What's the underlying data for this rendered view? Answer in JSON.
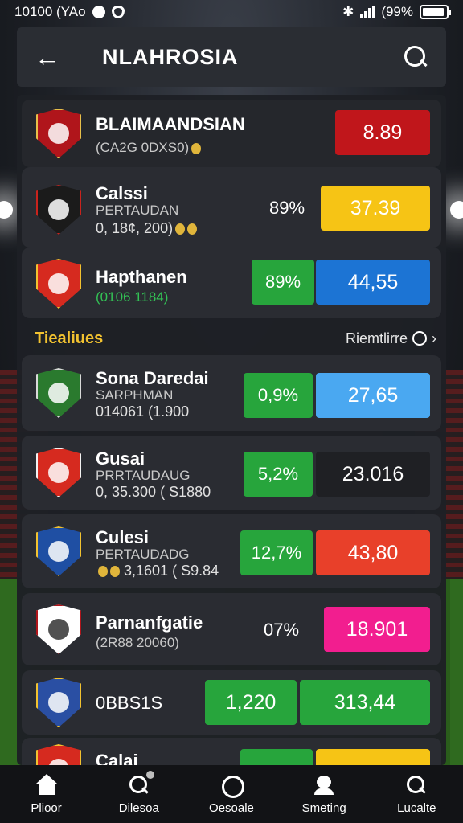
{
  "status_bar": {
    "time": "10100 (YAo",
    "battery": "(99%"
  },
  "header": {
    "title": "NLAHROSIA"
  },
  "featured": [
    {
      "name": "BLAIMAANDSIAN",
      "sub": "(CA2G 0DXS0)",
      "odds": "8.89",
      "odds_color": "#c0161b",
      "logo_color": "#b0151b"
    },
    {
      "name": "Calssi",
      "sub": "PERTAUDAN",
      "sub2": "0, 18¢, 200)",
      "pct": "89%",
      "odds": "37.39",
      "odds_color": "#f6c415",
      "logo_color": "#1b1b1b"
    },
    {
      "name": "Hapthanen",
      "sub": "(0106 1184)",
      "pct": "89%",
      "pct_bg": "#27a53c",
      "odds": "44,55",
      "odds_color": "#1c74d4",
      "logo_color": "#d62a1f"
    }
  ],
  "section": {
    "title": "Tiealiues",
    "link": "Riemtlirre"
  },
  "list": [
    {
      "name": "Sona Daredai",
      "sub": "SARPHMAN",
      "sub2": "014061 (1.900",
      "pct": "0,9%",
      "pct_bg": "#27a53c",
      "odds": "27,65",
      "odds_color": "#4aa8f1",
      "logo_color": "#2a7a2e"
    },
    {
      "name": "Gusai",
      "sub": "PRRTAUDAUG",
      "sub2": "0, 35.300 ( S1880",
      "pct": "5,2%",
      "pct_bg": "#27a53c",
      "odds": "23.016",
      "odds_color": "#1f2024",
      "logo_color": "#d62a1f"
    },
    {
      "name": "Culesi",
      "sub": "PERTAUDADG",
      "sub2": "3,1601 ( S9.84",
      "pct": "12,7%",
      "pct_bg": "#27a53c",
      "odds": "43,80",
      "odds_color": "#e8402a",
      "logo_color": "#1f4fa3"
    },
    {
      "name": "Parnanfgatie",
      "sub": "(2R88 20060)",
      "pct": "07%",
      "odds": "18.901",
      "odds_color": "#f21e8f",
      "logo_color": "#ffffff"
    },
    {
      "name": "0BBS1S",
      "pct": "1,220",
      "pct_bg": "#27a53c",
      "odds": "313,44",
      "odds_color": "#27a53c",
      "logo_color": "#2a4fa3"
    },
    {
      "name": "Calai",
      "pct": "",
      "pct_bg": "#27a53c",
      "odds": "",
      "odds_color": "#f6c415",
      "logo_color": "#d62a1f"
    }
  ],
  "nav": [
    {
      "label": "Plioor",
      "icon": "home-icon"
    },
    {
      "label": "Dilesoa",
      "icon": "search-icon"
    },
    {
      "label": "Oesoale",
      "icon": "circle-icon"
    },
    {
      "label": "Smeting",
      "icon": "person-icon"
    },
    {
      "label": "Lucalte",
      "icon": "search-icon"
    }
  ]
}
